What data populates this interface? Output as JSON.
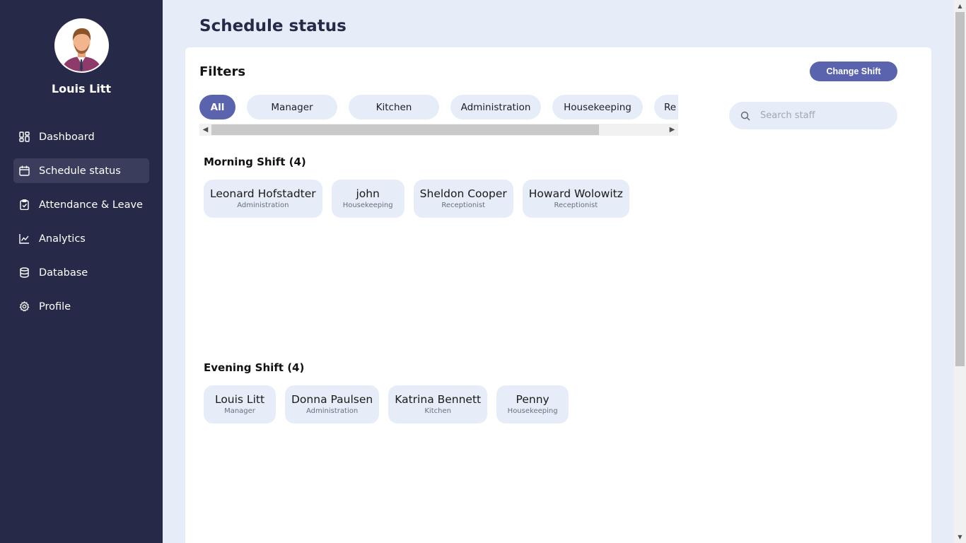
{
  "sidebar": {
    "user": {
      "name": "Louis Litt",
      "avatar_icon": "user-avatar-icon"
    },
    "items": [
      {
        "label": "Dashboard",
        "icon": "dashboard-icon"
      },
      {
        "label": "Schedule status",
        "icon": "calendar-icon",
        "active": true
      },
      {
        "label": "Attendance & Leave",
        "icon": "clipboard-check-icon"
      },
      {
        "label": "Analytics",
        "icon": "line-chart-icon"
      },
      {
        "label": "Database",
        "icon": "database-icon"
      },
      {
        "label": "Profile",
        "icon": "gear-icon"
      }
    ]
  },
  "page": {
    "title": "Schedule status"
  },
  "filters": {
    "title": "Filters",
    "change_shift_label": "Change Shift",
    "chips": [
      "All",
      "Manager",
      "Kitchen",
      "Administration",
      "Housekeeping",
      "Re"
    ],
    "active_chip": "All",
    "search_placeholder": "Search staff"
  },
  "shifts": [
    {
      "title": "Morning Shift (4)",
      "staff": [
        {
          "name": "Leonard Hofstadter",
          "role": "Administration"
        },
        {
          "name": "john",
          "role": "Housekeeping"
        },
        {
          "name": "Sheldon Cooper",
          "role": "Receptionist"
        },
        {
          "name": "Howard Wolowitz",
          "role": "Receptionist"
        }
      ]
    },
    {
      "title": "Evening Shift (4)",
      "staff": [
        {
          "name": "Louis Litt",
          "role": "Manager"
        },
        {
          "name": "Donna Paulsen",
          "role": "Administration"
        },
        {
          "name": "Katrina Bennett",
          "role": "Kitchen"
        },
        {
          "name": "Penny",
          "role": "Housekeeping"
        }
      ]
    }
  ],
  "colors": {
    "sidebar_bg": "#262a48",
    "accent": "#5a63ad",
    "page_bg": "#e6edf8"
  }
}
